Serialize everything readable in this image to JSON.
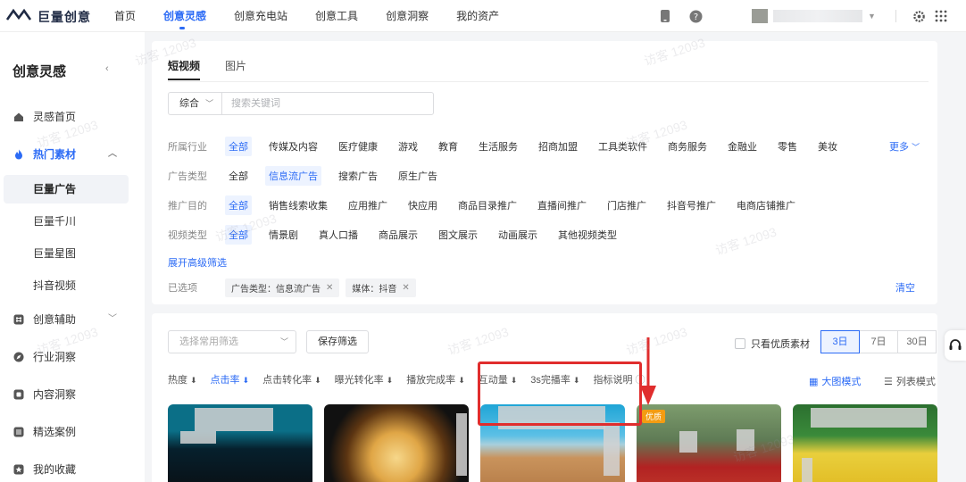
{
  "app": {
    "logo_text": "巨量创意",
    "nav": [
      "首页",
      "创意灵感",
      "创意充电站",
      "创意工具",
      "创意洞察",
      "我的资产"
    ],
    "nav_active": 1
  },
  "sidebar": {
    "title": "创意灵感",
    "items": [
      {
        "label": "灵感首页",
        "icon": "house-icon"
      },
      {
        "label": "热门素材",
        "icon": "flame-icon"
      },
      {
        "label": "创意辅助",
        "icon": "hash-icon"
      },
      {
        "label": "行业洞察",
        "icon": "compass-icon"
      },
      {
        "label": "内容洞察",
        "icon": "doc-icon"
      },
      {
        "label": "精选案例",
        "icon": "grid-icon"
      },
      {
        "label": "我的收藏",
        "icon": "star-icon"
      }
    ],
    "subitems": [
      "巨量广告",
      "巨量千川",
      "巨量星图",
      "抖音视频"
    ]
  },
  "content_tabs": [
    "短视频",
    "图片"
  ],
  "search": {
    "select_value": "综合",
    "placeholder": "搜索关键词"
  },
  "filters": {
    "industry": {
      "label": "所属行业",
      "options": [
        "全部",
        "传媒及内容",
        "医疗健康",
        "游戏",
        "教育",
        "生活服务",
        "招商加盟",
        "工具类软件",
        "商务服务",
        "金融业",
        "零售",
        "美妆"
      ],
      "more": "更多"
    },
    "ad_type": {
      "label": "广告类型",
      "options": [
        "全部",
        "信息流广告",
        "搜索广告",
        "原生广告"
      ]
    },
    "goal": {
      "label": "推广目的",
      "options": [
        "全部",
        "销售线索收集",
        "应用推广",
        "快应用",
        "商品目录推广",
        "直播间推广",
        "门店推广",
        "抖音号推广",
        "电商店铺推广"
      ]
    },
    "video_type": {
      "label": "视频类型",
      "options": [
        "全部",
        "情景剧",
        "真人口播",
        "商品展示",
        "图文展示",
        "动画展示",
        "其他视频类型"
      ]
    },
    "advanced_link": "展开高级筛选",
    "selected_label": "已选项",
    "chips": [
      "广告类型：信息流广告",
      "媒体：抖音"
    ],
    "clear": "清空"
  },
  "toolbar": {
    "preset_placeholder": "选择常用筛选",
    "save_label": "保存筛选",
    "quality_label": "只看优质素材",
    "ranges": [
      "3日",
      "7日",
      "30日"
    ]
  },
  "sorts": {
    "items": [
      "热度",
      "点击率",
      "点击转化率",
      "曝光转化率",
      "播放完成率",
      "互动量",
      "3s完播率"
    ],
    "note": "指标说明",
    "big_mode": "大图模式",
    "list_mode": "列表模式"
  },
  "cards": {
    "badge": "优质"
  },
  "watermark": "访客 12093",
  "colors": {
    "accent": "#2c6bf5",
    "highlight_border": "#e02d2d"
  }
}
